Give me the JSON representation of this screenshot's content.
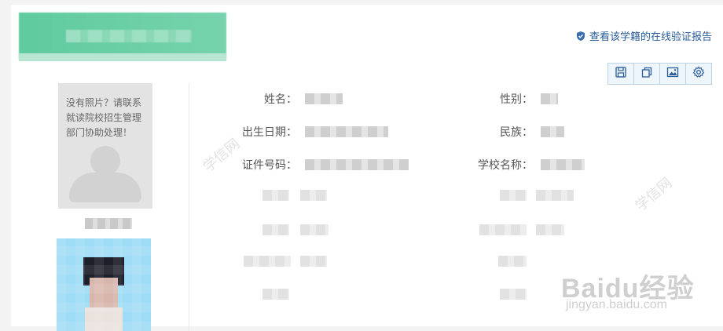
{
  "header": {
    "verify_link": "查看该学籍的在线验证报告"
  },
  "toolbar": {
    "buttons": [
      {
        "icon": "save-icon"
      },
      {
        "icon": "copy-icon"
      },
      {
        "icon": "image-icon"
      },
      {
        "icon": "settings-icon"
      }
    ]
  },
  "photo": {
    "no_photo_message": "没有照片？请联系就读院校招生管理部门协助处理！"
  },
  "fields": {
    "name_label": "姓名：",
    "gender_label": "性别：",
    "birth_label": "出生日期：",
    "ethnicity_label": "民族：",
    "id_label": "证件号码：",
    "school_label": "学校名称："
  },
  "watermarks": {
    "site_text": "学信网",
    "baidu_text": "Baidu经验",
    "baidu_url": "jingyan.baidu.com"
  },
  "colors": {
    "banner": "#66cca3",
    "link": "#2a5d9a",
    "toolbar_border": "#bcd3e6"
  }
}
